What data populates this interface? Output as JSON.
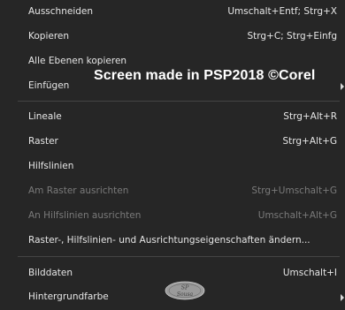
{
  "menu": {
    "items": [
      {
        "label": "Ausschneiden",
        "shortcut": "Umschalt+Entf; Strg+X"
      },
      {
        "label": "Kopieren",
        "shortcut": "Strg+C; Strg+Einfg"
      },
      {
        "label": "Alle Ebenen kopieren",
        "shortcut": ""
      },
      {
        "label": "Einfügen",
        "shortcut": ""
      },
      {
        "label": "Lineale",
        "shortcut": "Strg+Alt+R"
      },
      {
        "label": "Raster",
        "shortcut": "Strg+Alt+G"
      },
      {
        "label": "Hilfslinien",
        "shortcut": ""
      },
      {
        "label": "Am Raster ausrichten",
        "shortcut": "Strg+Umschalt+G"
      },
      {
        "label": "An Hilfslinien ausrichten",
        "shortcut": "Umschalt+Alt+G"
      },
      {
        "label": "Raster-, Hilfslinien- und Ausrichtungseigenschaften ändern...",
        "shortcut": ""
      },
      {
        "label": "Bilddaten",
        "shortcut": "Umschalt+I"
      },
      {
        "label": "Hintergrundfarbe",
        "shortcut": ""
      }
    ]
  },
  "watermark": {
    "text": "Screen made in PSP2018 ©Corel",
    "logo_text_top": "SP",
    "logo_text_bottom": "Sousa"
  },
  "colors": {
    "background": "#262626",
    "text": "#e6e6e6",
    "disabled_text": "#7a7a7a",
    "separator": "#444444"
  }
}
